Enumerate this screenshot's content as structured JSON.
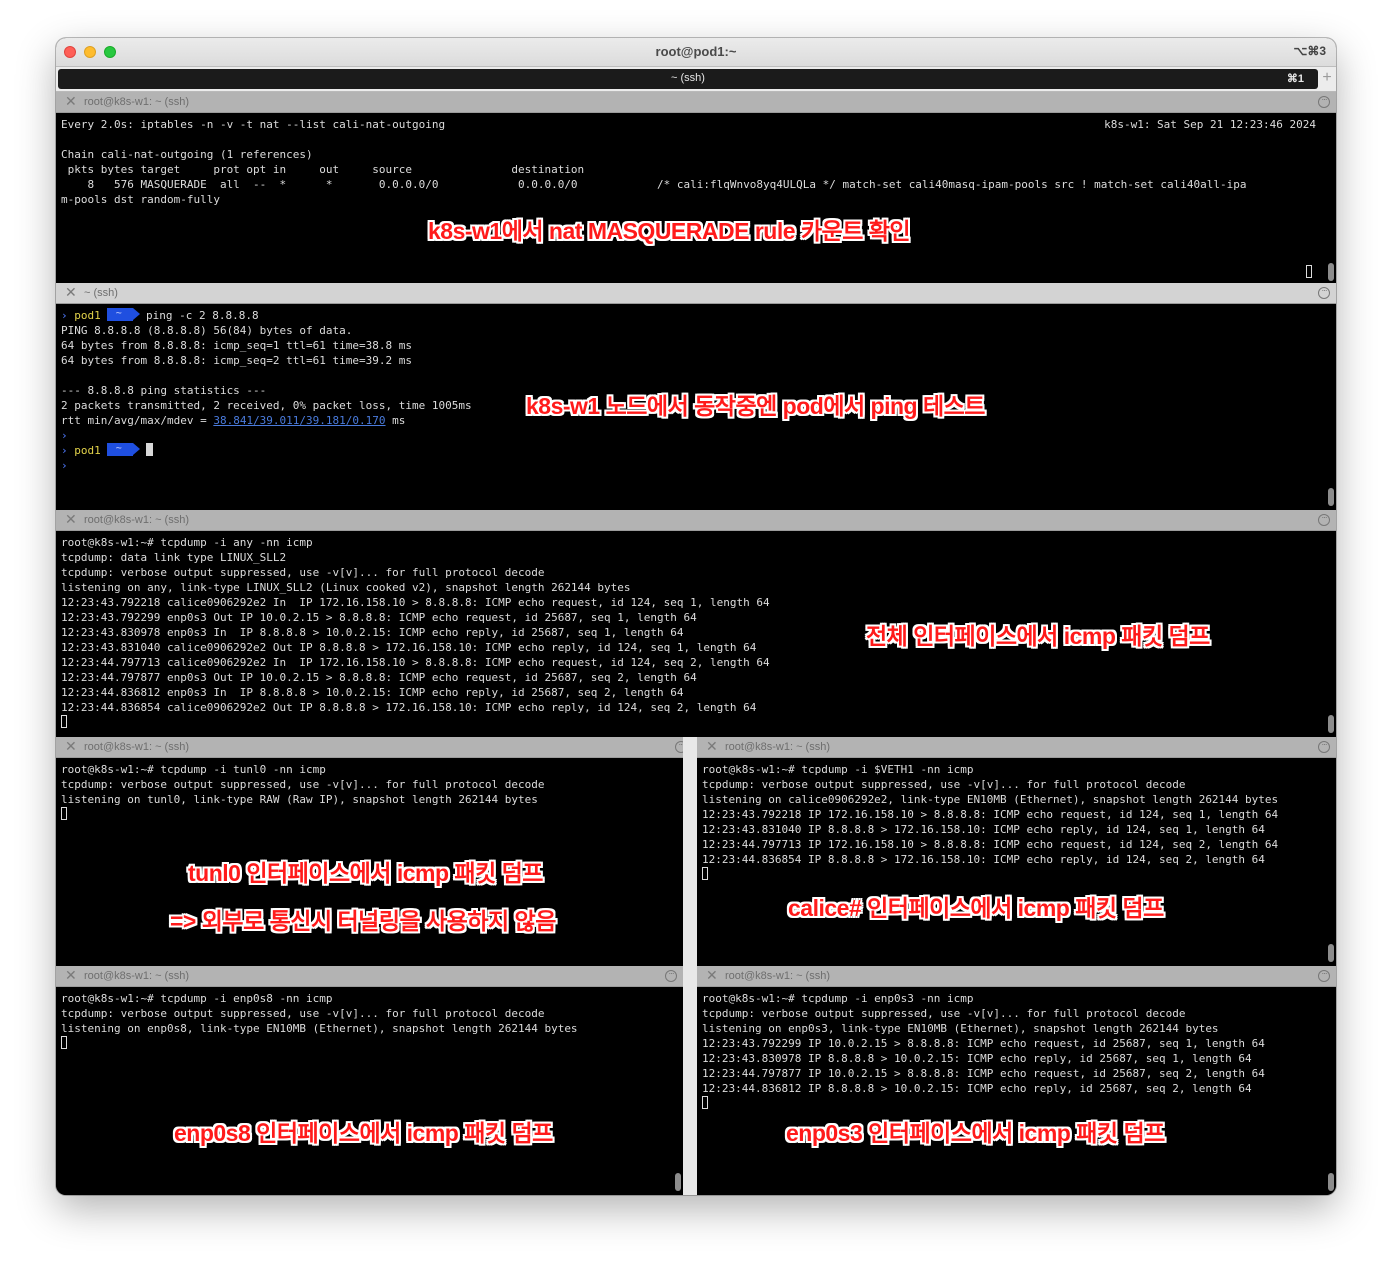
{
  "window": {
    "title": "root@pod1:~",
    "shortcut": "⌥⌘3",
    "tab_label": "~ (ssh)",
    "tab_shortcut": "⌘1",
    "tab_plus": "+"
  },
  "panes": {
    "iptables": {
      "header": "root@k8s-w1: ~ (ssh)",
      "time": "k8s-w1: Sat Sep 21 12:23:46 2024",
      "lines": [
        "Every 2.0s: iptables -n -v -t nat --list cali-nat-outgoing",
        "",
        "Chain cali-nat-outgoing (1 references)",
        " pkts bytes target     prot opt in     out     source               destination",
        "    8   576 MASQUERADE  all  --  *      *       0.0.0.0/0            0.0.0.0/0            /* cali:flqWnvo8yq4ULQLa */ match-set cali40masq-ipam-pools src ! match-set cali40all-ipa",
        "m-pools dst random-fully"
      ],
      "annotation": "k8s-w1에서 nat MASQUERADE rule 카운트 확인"
    },
    "ping": {
      "header": "~ (ssh)",
      "prompt_host": "pod1",
      "prompt_dir": "~",
      "command": "ping -c 2 8.8.8.8",
      "lines": [
        "PING 8.8.8.8 (8.8.8.8) 56(84) bytes of data.",
        "64 bytes from 8.8.8.8: icmp_seq=1 ttl=61 time=38.8 ms",
        "64 bytes from 8.8.8.8: icmp_seq=2 ttl=61 time=39.2 ms",
        "",
        "--- 8.8.8.8 ping statistics ---",
        "2 packets transmitted, 2 received, 0% packet loss, time 1005ms"
      ],
      "rtt_prefix": "rtt min/avg/max/mdev = ",
      "rtt_values": "38.841/39.011/39.181/0.170",
      "rtt_suffix": " ms",
      "annotation": "k8s-w1 노드에서 동작중엔 pod에서 ping 테스트"
    },
    "any": {
      "header": "root@k8s-w1: ~ (ssh)",
      "lines": [
        "root@k8s-w1:~# tcpdump -i any -nn icmp",
        "tcpdump: data link type LINUX_SLL2",
        "tcpdump: verbose output suppressed, use -v[v]... for full protocol decode",
        "listening on any, link-type LINUX_SLL2 (Linux cooked v2), snapshot length 262144 bytes",
        "12:23:43.792218 calice0906292e2 In  IP 172.16.158.10 > 8.8.8.8: ICMP echo request, id 124, seq 1, length 64",
        "12:23:43.792299 enp0s3 Out IP 10.0.2.15 > 8.8.8.8: ICMP echo request, id 25687, seq 1, length 64",
        "12:23:43.830978 enp0s3 In  IP 8.8.8.8 > 10.0.2.15: ICMP echo reply, id 25687, seq 1, length 64",
        "12:23:43.831040 calice0906292e2 Out IP 8.8.8.8 > 172.16.158.10: ICMP echo reply, id 124, seq 1, length 64",
        "12:23:44.797713 calice0906292e2 In  IP 172.16.158.10 > 8.8.8.8: ICMP echo request, id 124, seq 2, length 64",
        "12:23:44.797877 enp0s3 Out IP 10.0.2.15 > 8.8.8.8: ICMP echo request, id 25687, seq 2, length 64",
        "12:23:44.836812 enp0s3 In  IP 8.8.8.8 > 10.0.2.15: ICMP echo reply, id 25687, seq 2, length 64",
        "12:23:44.836854 calice0906292e2 Out IP 8.8.8.8 > 172.16.158.10: ICMP echo reply, id 124, seq 2, length 64"
      ],
      "annotation": "전체 인터페이스에서 icmp 패킷 덤프"
    },
    "tunl0": {
      "header": "root@k8s-w1: ~ (ssh)",
      "lines": [
        "root@k8s-w1:~# tcpdump -i tunl0 -nn icmp",
        "tcpdump: verbose output suppressed, use -v[v]... for full protocol decode",
        "listening on tunl0, link-type RAW (Raw IP), snapshot length 262144 bytes"
      ],
      "annotation": "tunl0 인터페이스에서 icmp 패킷 덤프",
      "annotation2": "=> 외부로 통신시 터널링을 사용하지 않음"
    },
    "veth": {
      "header": "root@k8s-w1: ~ (ssh)",
      "lines": [
        "root@k8s-w1:~# tcpdump -i $VETH1 -nn icmp",
        "tcpdump: verbose output suppressed, use -v[v]... for full protocol decode",
        "listening on calice0906292e2, link-type EN10MB (Ethernet), snapshot length 262144 bytes",
        "12:23:43.792218 IP 172.16.158.10 > 8.8.8.8: ICMP echo request, id 124, seq 1, length 64",
        "12:23:43.831040 IP 8.8.8.8 > 172.16.158.10: ICMP echo reply, id 124, seq 1, length 64",
        "12:23:44.797713 IP 172.16.158.10 > 8.8.8.8: ICMP echo request, id 124, seq 2, length 64",
        "12:23:44.836854 IP 8.8.8.8 > 172.16.158.10: ICMP echo reply, id 124, seq 2, length 64"
      ],
      "annotation": "calice# 인터페이스에서 icmp 패킷 덤프"
    },
    "enp0s8": {
      "header": "root@k8s-w1: ~ (ssh)",
      "lines": [
        "root@k8s-w1:~# tcpdump -i enp0s8 -nn icmp",
        "tcpdump: verbose output suppressed, use -v[v]... for full protocol decode",
        "listening on enp0s8, link-type EN10MB (Ethernet), snapshot length 262144 bytes"
      ],
      "annotation": "enp0s8 인터페이스에서 icmp 패킷 덤프"
    },
    "enp0s3": {
      "header": "root@k8s-w1: ~ (ssh)",
      "lines": [
        "root@k8s-w1:~# tcpdump -i enp0s3 -nn icmp",
        "tcpdump: verbose output suppressed, use -v[v]... for full protocol decode",
        "listening on enp0s3, link-type EN10MB (Ethernet), snapshot length 262144 bytes",
        "12:23:43.792299 IP 10.0.2.15 > 8.8.8.8: ICMP echo request, id 25687, seq 1, length 64",
        "12:23:43.830978 IP 8.8.8.8 > 10.0.2.15: ICMP echo reply, id 25687, seq 1, length 64",
        "12:23:44.797877 IP 10.0.2.15 > 8.8.8.8: ICMP echo request, id 25687, seq 2, length 64",
        "12:23:44.836812 IP 8.8.8.8 > 10.0.2.15: ICMP echo reply, id 25687, seq 2, length 64"
      ],
      "annotation": "enp0s3 인터페이스에서 icmp 패킷 덤프"
    }
  },
  "colors": {
    "annotation": "#ff1a1a",
    "prompt_host": "#e2d24a",
    "prompt_segment": "#1f4fe0",
    "link": "#4a7bdc"
  }
}
